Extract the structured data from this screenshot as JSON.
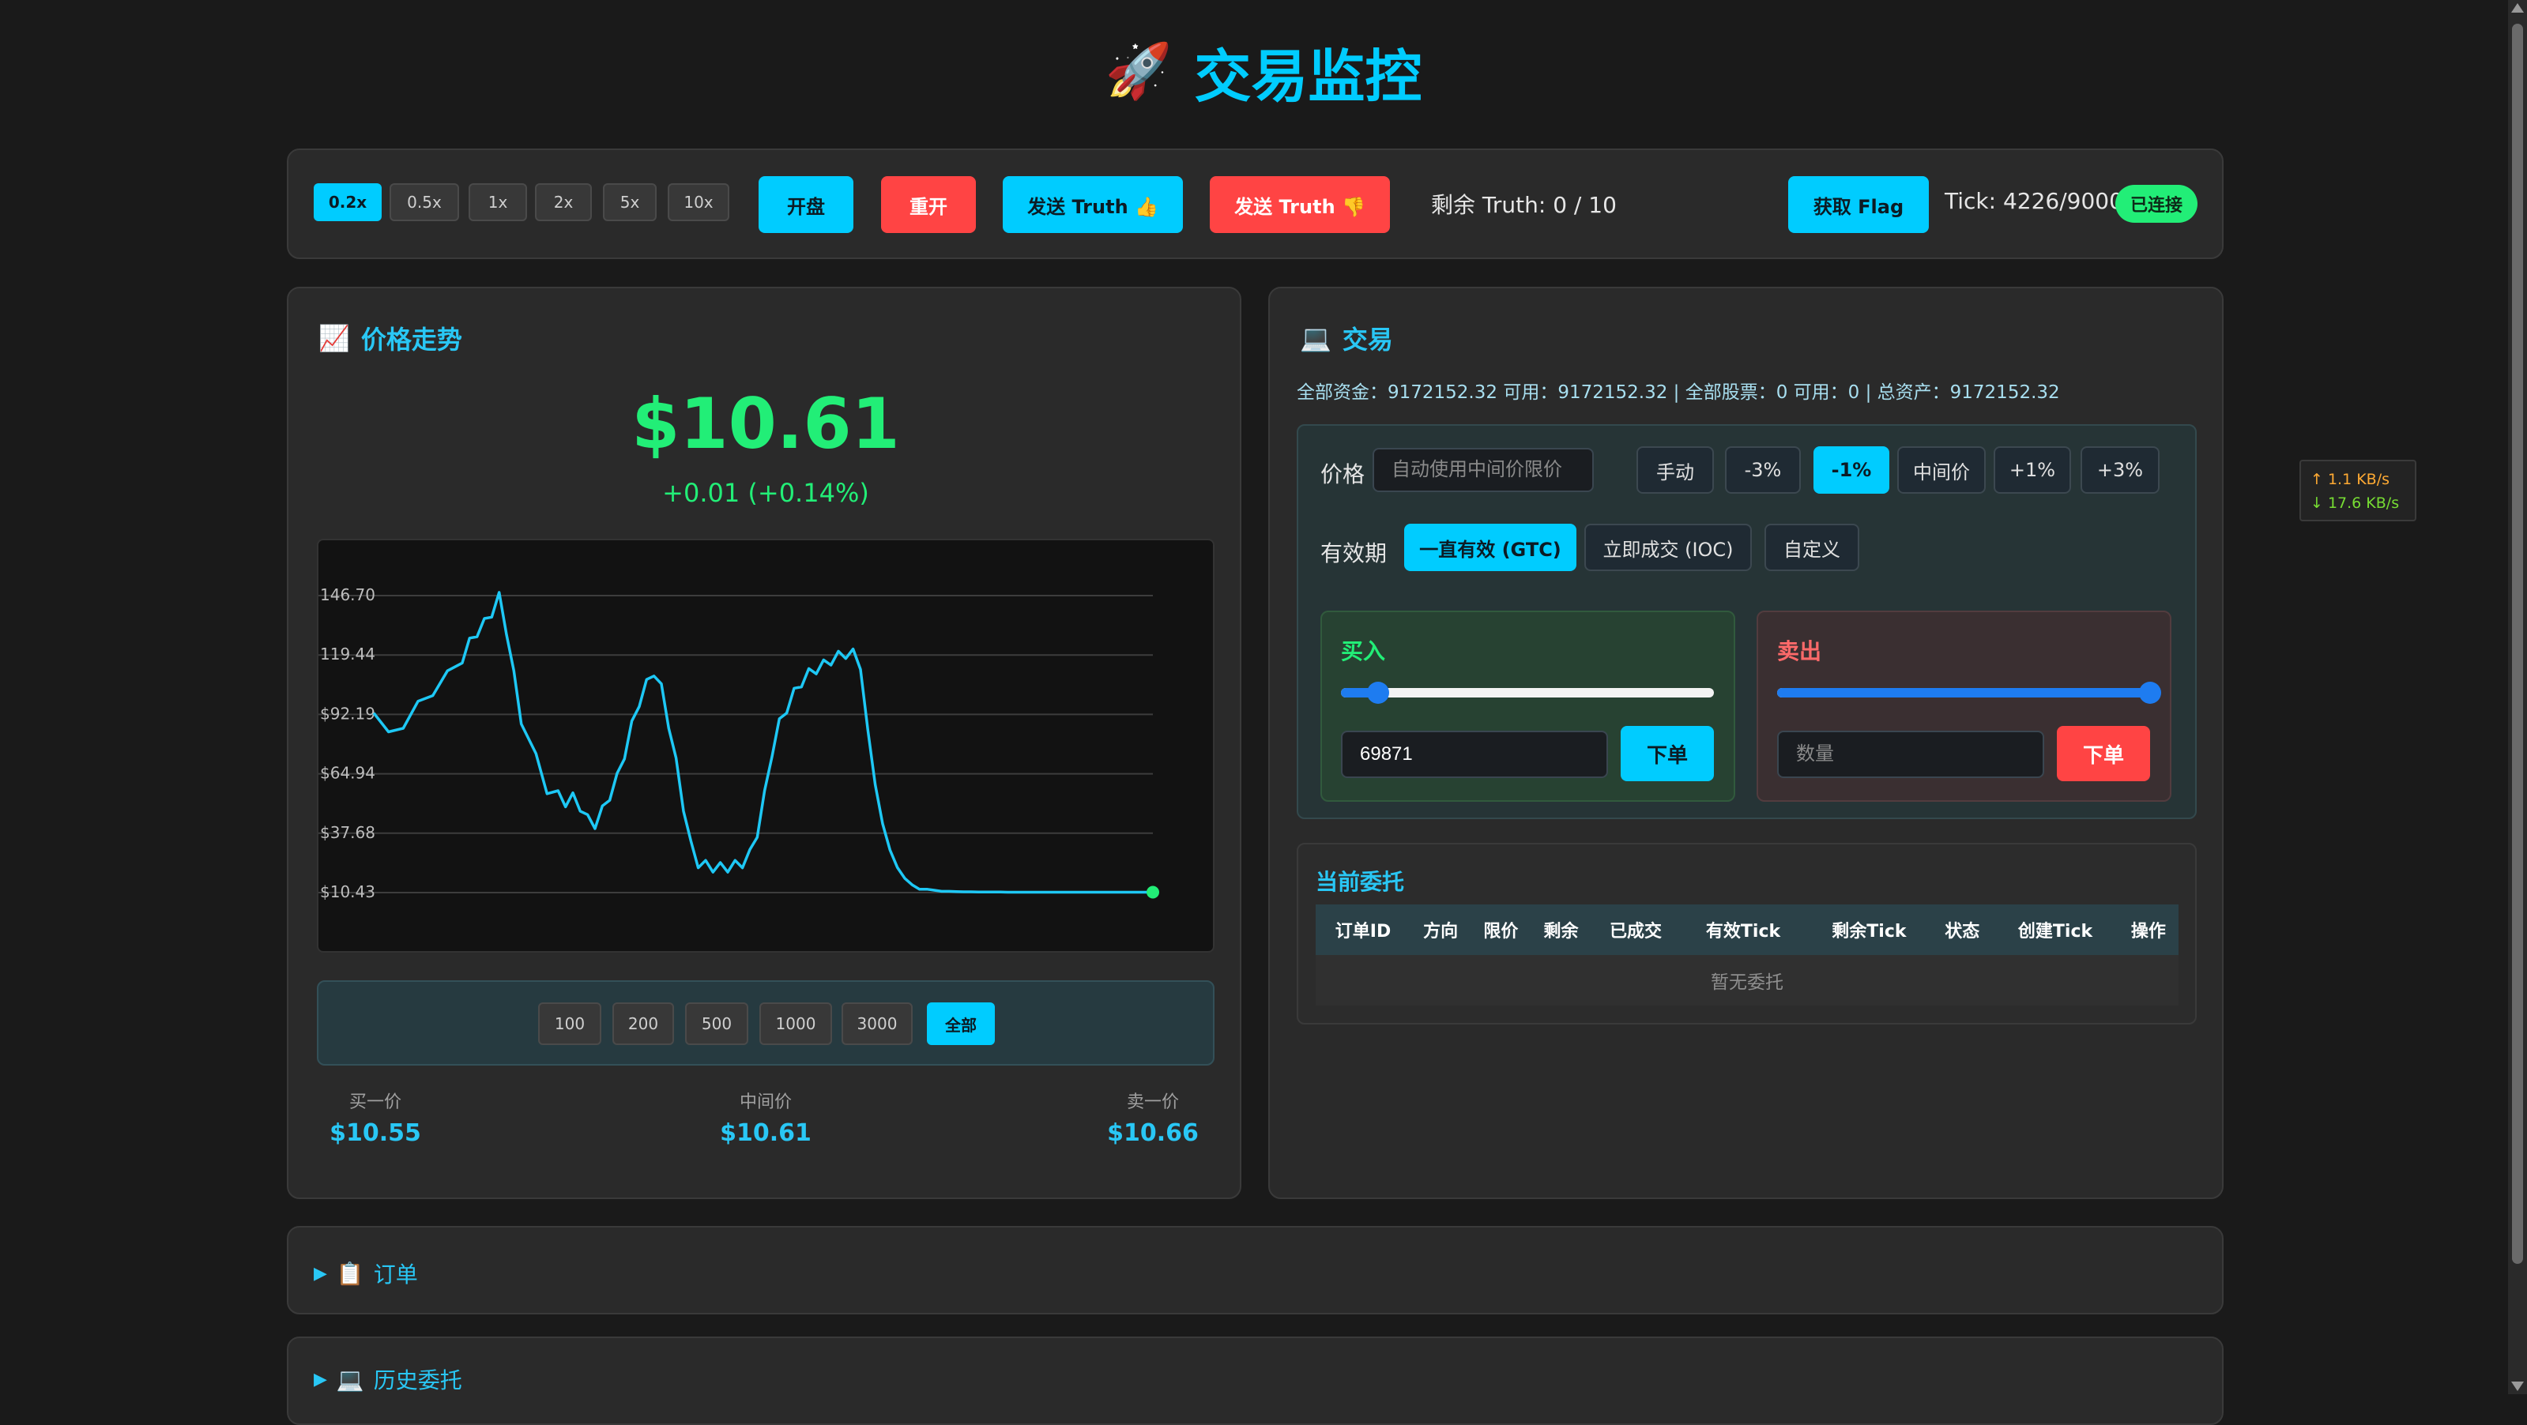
{
  "header": {
    "rocket_icon": "🚀",
    "title": "交易监控"
  },
  "toolbar": {
    "speeds": [
      "0.2x",
      "0.5x",
      "1x",
      "2x",
      "5x",
      "10x"
    ],
    "active_speed": "0.2x",
    "open_label": "开盘",
    "reopen_label": "重开",
    "truth_up_label": "发送 Truth 👍",
    "truth_down_label": "发送 Truth 👎",
    "truth_remaining": "剩余 Truth: 0 / 10",
    "flag_label": "获取 Flag",
    "tick": "Tick: 4226/9000",
    "status": "已连接"
  },
  "price_panel": {
    "icon": "📈",
    "title": "价格走势",
    "price": "$10.61",
    "change": "+0.01 (+0.14%)",
    "ranges": [
      "100",
      "200",
      "500",
      "1000",
      "3000",
      "全部"
    ],
    "active_range": "全部",
    "bid_label": "买一价",
    "bid": "$10.55",
    "mid_label": "中间价",
    "mid": "$10.61",
    "ask_label": "卖一价",
    "ask": "$10.66"
  },
  "trade_panel": {
    "icon": "💻",
    "title": "交易",
    "summary": "全部资金：9172152.32 可用：9172152.32 | 全部股票：0 可用：0 | 总资产：9172152.32",
    "price_label": "价格",
    "price_placeholder": "自动使用中间价限价",
    "price_buttons": [
      "手动",
      "-3%",
      "-1%",
      "中间价",
      "+1%",
      "+3%"
    ],
    "active_price_button": "-1%",
    "validity_label": "有效期",
    "validity_buttons": [
      "一直有效 (GTC)",
      "立即成交 (IOC)",
      "自定义"
    ],
    "active_validity": "一直有效 (GTC)",
    "buy": {
      "title": "买入",
      "slider_fraction": 0.1,
      "quantity": "69871",
      "submit": "下单"
    },
    "sell": {
      "title": "卖出",
      "slider_fraction": 1.0,
      "placeholder": "数量",
      "submit": "下单"
    }
  },
  "orders": {
    "title": "当前委托",
    "columns": [
      "订单ID",
      "方向",
      "限价",
      "剩余",
      "已成交",
      "有效Tick",
      "剩余Tick",
      "状态",
      "创建Tick",
      "操作"
    ],
    "empty": "暂无委托"
  },
  "collapsibles": [
    {
      "arrow": "▶",
      "icon": "📋",
      "label": "订单"
    },
    {
      "arrow": "▶",
      "icon": "💻",
      "label": "历史委托"
    }
  ],
  "network": {
    "up": "↑ 1.1 KB/s",
    "down": "↓ 17.6 KB/s"
  },
  "colors": {
    "accent": "#00ccff",
    "red": "#ff4444",
    "green": "#22ee77",
    "line": "#1ec8f5"
  },
  "chart_data": {
    "type": "line",
    "title": "",
    "xlabel": "",
    "ylabel": "",
    "y_ticks": [
      "146.70",
      "119.44",
      "$92.19",
      "$64.94",
      "$37.68",
      "$10.43"
    ],
    "ylim": [
      10.43,
      146.7
    ],
    "grid": true,
    "series": [
      {
        "x": [
          0,
          80,
          160,
          240,
          320,
          400,
          480,
          520,
          560,
          600,
          640,
          680,
          720,
          760,
          800,
          880,
          940,
          1000,
          1040,
          1080,
          1120,
          1160,
          1200,
          1240,
          1280,
          1320,
          1360,
          1400,
          1440,
          1480,
          1520,
          1560,
          1600,
          1640,
          1680,
          1720,
          1760,
          1800,
          1840,
          1880,
          1920,
          1960,
          2000,
          2040,
          2080,
          2120,
          2160,
          2200,
          2240,
          2280,
          2320,
          2360,
          2400,
          2440,
          2480,
          2520,
          2560,
          2600,
          2640,
          2680,
          2720,
          2760,
          2800,
          2840,
          2880,
          2920,
          2960,
          3000,
          3040,
          3080,
          3120,
          3160,
          3200,
          3240,
          3280,
          3320,
          3360,
          3400,
          3440,
          3480,
          3520,
          3560,
          3600,
          3640,
          3680,
          3720,
          3760,
          3800,
          3840,
          3880,
          3920,
          3960,
          4000,
          4040,
          4080,
          4120,
          4160,
          4200,
          4226
        ],
        "values": [
          95,
          82,
          88,
          96,
          103,
          110,
          118,
          125,
          130,
          134,
          139,
          146,
          131,
          110,
          90,
          72,
          58,
          55,
          52,
          54,
          50,
          44,
          42,
          48,
          55,
          63,
          74,
          87,
          98,
          106,
          112,
          104,
          88,
          70,
          50,
          32,
          24,
          23,
          22,
          22,
          22,
          23,
          24,
          28,
          38,
          55,
          75,
          88,
          95,
          102,
          107,
          111,
          113,
          115,
          117,
          119,
          120,
          120,
          115,
          85,
          60,
          42,
          30,
          22,
          17,
          14,
          12,
          12,
          11.5,
          11,
          11,
          10.9,
          10.8,
          10.8,
          10.7,
          10.7,
          10.7,
          10.7,
          10.6,
          10.6,
          10.6,
          10.6,
          10.6,
          10.6,
          10.6,
          10.6,
          10.6,
          10.6,
          10.6,
          10.6,
          10.6,
          10.6,
          10.6,
          10.6,
          10.6,
          10.6,
          10.6,
          10.6,
          10.61
        ]
      }
    ]
  }
}
